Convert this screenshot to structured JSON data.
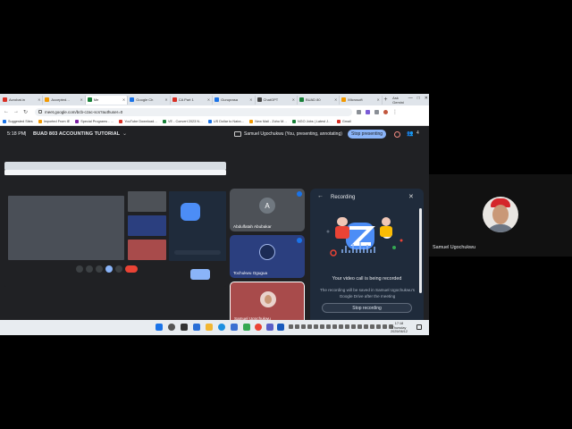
{
  "browser": {
    "tabs": [
      {
        "label": "Acrobat.in",
        "color": "#d93025"
      },
      {
        "label": "Accepted…",
        "color": "#f29900"
      },
      {
        "label": "Me",
        "color": "#188038",
        "active": true
      },
      {
        "label": "Google Ch",
        "color": "#1a73e8"
      },
      {
        "label": "CA Part 1",
        "color": "#d93025"
      },
      {
        "label": "Guruprasa",
        "color": "#1a73e8"
      },
      {
        "label": "ChatGPT",
        "color": "#444444"
      },
      {
        "label": "BUAD 80",
        "color": "#188038"
      },
      {
        "label": "Microsoft",
        "color": "#f29900"
      }
    ],
    "new_tab": "+",
    "gemini_label": "Ask Gemini",
    "window_controls": [
      "—",
      "□",
      "✕"
    ],
    "url": "meet.google.com/bcb-czac-scs?authuser=0",
    "bookmarks": [
      {
        "label": "Suggested Sites",
        "color": "#1a73e8"
      },
      {
        "label": "Imported From IE",
        "color": "#f29900"
      },
      {
        "label": "Special Programs - …",
        "color": "#7b1fa2"
      },
      {
        "label": "YouTube Download…",
        "color": "#d93025"
      },
      {
        "label": "VE - Convert 2023 N…",
        "color": "#188038"
      },
      {
        "label": "US Dollar to Naira…",
        "color": "#1a73e8"
      },
      {
        "label": "New Mail - Zoho M…",
        "color": "#f29900"
      },
      {
        "label": "NGO Jobs | Latest J…",
        "color": "#188038"
      },
      {
        "label": "Gmail",
        "color": "#d93025"
      }
    ]
  },
  "meet": {
    "time": "5:18 PM",
    "separator": "|",
    "title": "BUAD 803 ACCOUNTING TUTORIAL",
    "presenter_label": "Samuel Ugochukwu (You, presenting, annotating)",
    "stop_presenting": "Stop presenting",
    "participants_count": "4",
    "tiles": [
      {
        "name": "Abdulfatah Abubakar",
        "initial": "A",
        "bg": "#4d5157",
        "avatar_bg": "#707880"
      },
      {
        "name": "Tochukwu Ogugua",
        "initial": "",
        "bg": "#2b3f7f",
        "avatar_bg": "#1b2b55"
      },
      {
        "name": "Samuel Ugochukwu",
        "initial": "",
        "bg": "#a84b4b",
        "avatar_bg": "#e9d3cc"
      }
    ],
    "recording_panel": {
      "title": "Recording",
      "heading": "Your video call is being recorded",
      "description": "The recording will be saved in Samuel Ugochukwu's Google Drive after the meeting",
      "stop_button": "Stop recording"
    }
  },
  "taskbar": {
    "clock_time": "17:18",
    "clock_day": "Thursday",
    "clock_date": "2025/06/12"
  },
  "self_view": {
    "name": "Samuel Ugochukwu"
  },
  "colors": {
    "accent": "#8ab4f8",
    "end_call": "#ea4335",
    "meet_bg": "#202124",
    "panel_bg": "#1f2b3b"
  }
}
